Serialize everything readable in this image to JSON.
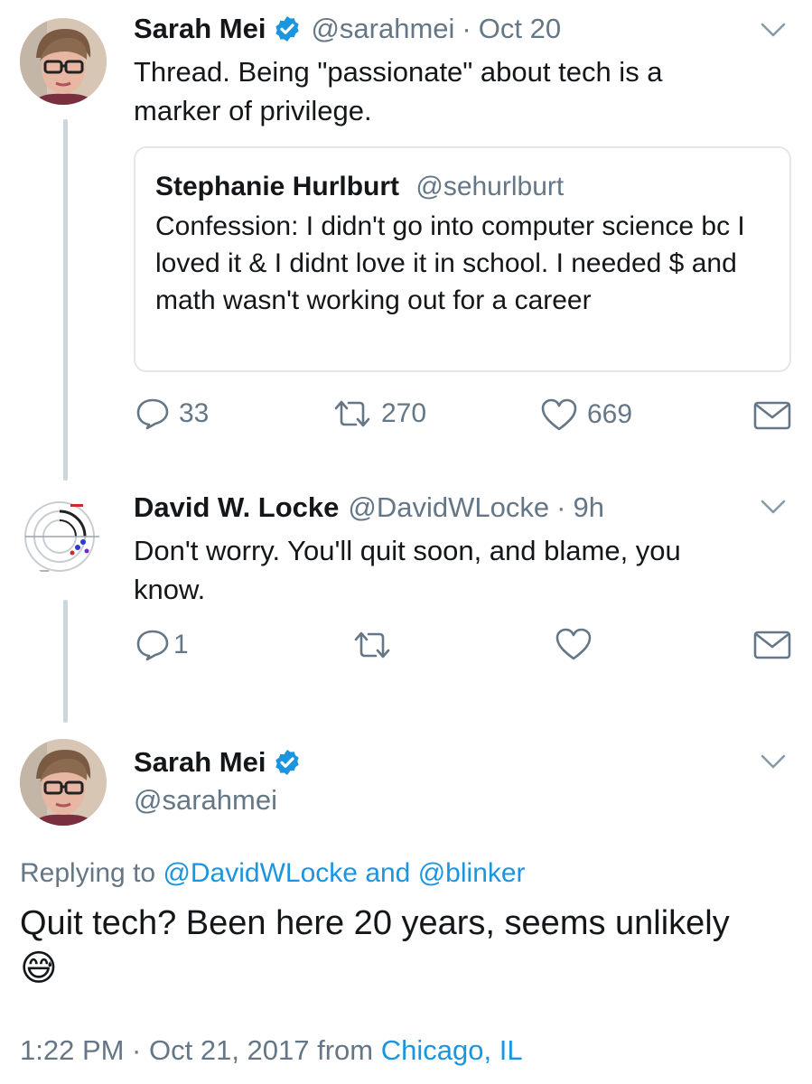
{
  "colors": {
    "accent": "#1b95e0",
    "secondary": "#657786",
    "text": "#14171a",
    "border": "#e1e8ed",
    "thread_line": "#ccd6dd"
  },
  "tweet1": {
    "name": "Sarah Mei",
    "handle": "@sarahmei",
    "separator": "·",
    "time": "Oct 20",
    "text": "Thread. Being \"passionate\" about tech is a marker of privilege.",
    "quote": {
      "name": "Stephanie Hurlburt",
      "handle": "@sehurlburt",
      "text": "Confession: I didn't go into computer science bc I loved it & I didnt love it in school. I needed $ and math wasn't working out for a career"
    },
    "actions": {
      "replies": "33",
      "retweets": "270",
      "likes": "669"
    }
  },
  "tweet2": {
    "name": "David W. Locke",
    "handle": "@DavidWLocke",
    "separator": "·",
    "time": "9h",
    "text": "Don't worry. You'll quit soon, and blame, you know.",
    "actions": {
      "replies": "1"
    }
  },
  "tweet3": {
    "name": "Sarah Mei",
    "handle": "@sarahmei",
    "replying_prefix": "Replying to",
    "replying_user1": "@DavidWLocke",
    "replying_and": "and",
    "replying_user2": "@blinker",
    "text": "Quit tech? Been here 20 years, seems unlikely",
    "emoji": "😅",
    "timestamp": "1:22 PM · Oct 21, 2017 from",
    "location": "Chicago, IL"
  },
  "icons": {
    "reply": "reply-icon",
    "retweet": "retweet-icon",
    "like": "heart-icon",
    "dm": "envelope-icon",
    "verified": "verified-badge-icon",
    "menu": "chevron-down-icon"
  }
}
